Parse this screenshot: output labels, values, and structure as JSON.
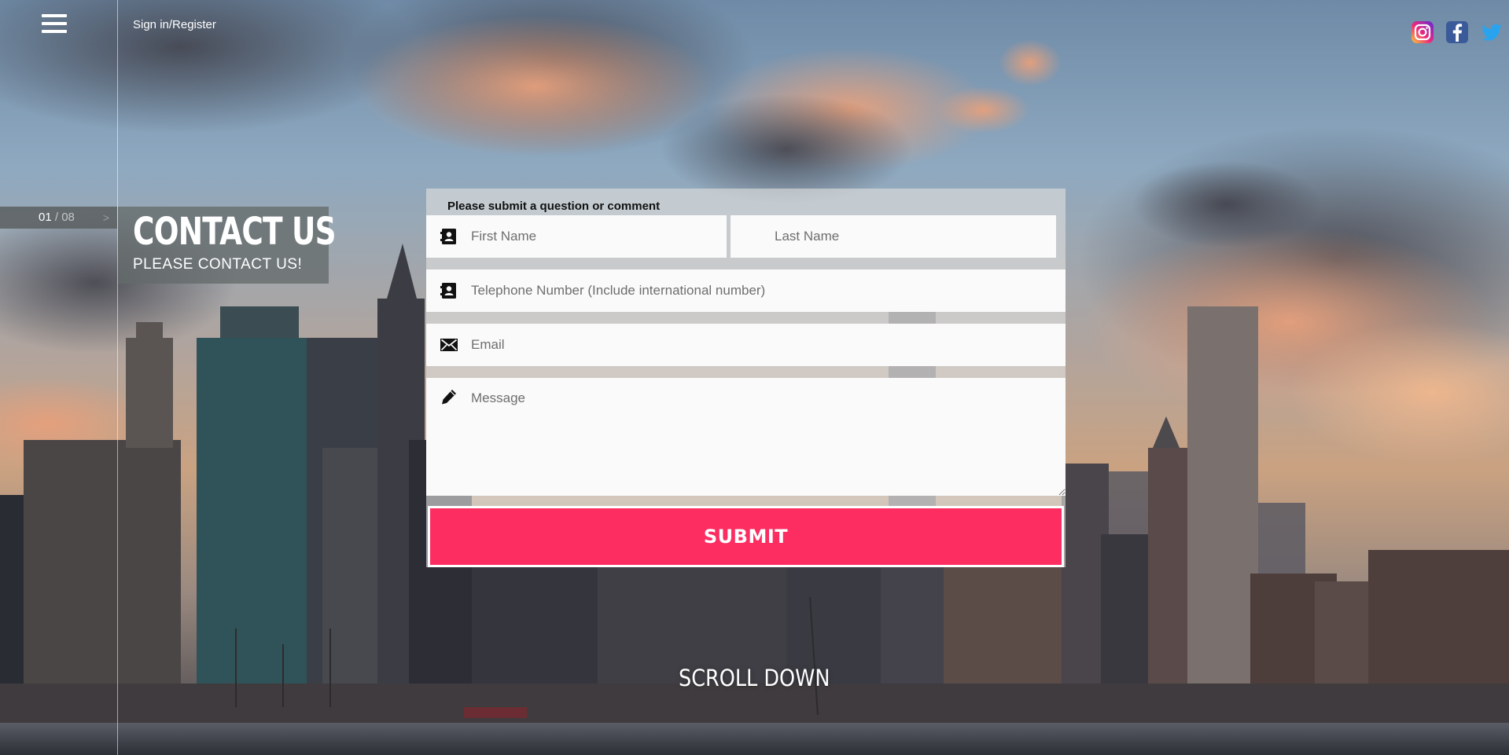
{
  "header": {
    "menu_icon": "hamburger-menu-icon",
    "sign_in_label": "Sign in/Register"
  },
  "slide_counter": {
    "current": "01",
    "separator": "/",
    "total": "08",
    "next_icon": "chevron-right-icon"
  },
  "page": {
    "title": "CONTACT US",
    "subtitle": "PLEASE CONTACT US!"
  },
  "social": [
    {
      "name": "instagram",
      "icon": "instagram-icon"
    },
    {
      "name": "facebook",
      "icon": "facebook-icon"
    },
    {
      "name": "twitter",
      "icon": "twitter-icon"
    }
  ],
  "form": {
    "heading": "Please submit a question or comment",
    "first_name": {
      "placeholder": "First Name",
      "value": "",
      "icon": "contact-card-icon"
    },
    "last_name": {
      "placeholder": "Last Name",
      "value": ""
    },
    "telephone": {
      "placeholder": "Telephone Number (Include international number)",
      "value": "",
      "icon": "contact-card-icon"
    },
    "email": {
      "placeholder": "Email",
      "value": "",
      "icon": "envelope-icon"
    },
    "message": {
      "placeholder": "Message",
      "value": "",
      "icon": "pencil-icon"
    },
    "submit_label": "SUBMIT"
  },
  "footer": {
    "scroll_label": "SCROLL DOWN"
  },
  "colors": {
    "submit": "#fd2d62",
    "panel": "#e1e1de",
    "title_box": "#646a6a"
  }
}
